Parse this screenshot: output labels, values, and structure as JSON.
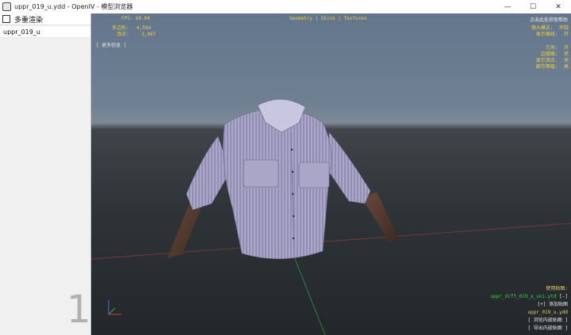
{
  "window": {
    "title": "uppr_019_u.ydd - OpenIV - 模型浏览器",
    "minimize_glyph": "—",
    "maximize_glyph": "☐",
    "close_glyph": "✕"
  },
  "sidebar": {
    "multi_render_label": "多重渲染",
    "multi_render_checked": false,
    "items": [
      {
        "label": "uppr_019_u"
      }
    ],
    "lod_number": "1"
  },
  "viewport": {
    "fps_text": "FPS: 60.04",
    "stats": {
      "polygons_label": "多边形:",
      "polygons_value": "4,594",
      "vertices_label": "顶点:",
      "vertices_value": "2,907"
    },
    "more_info": "[ 更多信息 ]",
    "top_tabs": "Geometry | Skins | Textures",
    "top_right_hint": "点击此处获取帮助",
    "camera": {
      "mode_label": "镜头模式:",
      "mode_value": "环绕",
      "grid_label": "显示格线:",
      "grid_value": "开"
    },
    "render": {
      "geometry_label": "几何:",
      "geometry_value": "开",
      "wireframe_label": "边缘图:",
      "wireframe_value": "关",
      "vertices_label": "显示顶点:",
      "vertices_value": "关",
      "detail_label": "细节等级:",
      "detail_value": "高"
    },
    "textures": {
      "heading": "使用贴图:",
      "diff_file": "uppr_diff_019_a_uni.ytd",
      "diff_flag": "[-]",
      "add_texture": "[+] 添加贴图",
      "model_file": "uppr_019_u.ydd",
      "browse_embedded": "[ 浏览内嵌贴图 ]",
      "export_embedded": "[ 导出内嵌贴图 ]"
    },
    "colors": {
      "accent_yellow": "#f1d14a",
      "accent_green": "#38d04f",
      "text_white": "#e9e9e9"
    }
  }
}
